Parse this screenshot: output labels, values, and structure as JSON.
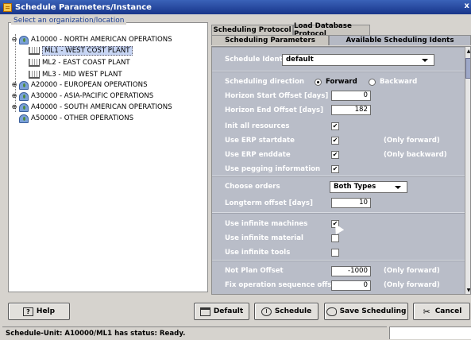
{
  "window": {
    "title": "Schedule Parameters/Instance",
    "close_glyph": "x"
  },
  "tree": {
    "legend": "Select an organization/location",
    "nodes": [
      {
        "label": "A10000 - NORTH AMERICAN OPERATIONS",
        "toggle": "⊖",
        "icon": "globe-icon"
      },
      {
        "label": "ML1 - WEST COST PLANT",
        "icon": "factory-icon",
        "selected": true
      },
      {
        "label": "ML2 - EAST COAST PLANT",
        "icon": "factory-icon"
      },
      {
        "label": "ML3 - MID WEST PLANT",
        "icon": "factory-icon"
      },
      {
        "label": "A20000 - EUROPEAN OPERATIONS",
        "toggle": "⊕",
        "icon": "globe-icon"
      },
      {
        "label": "A30000 - ASIA-PACIFIC OPERATIONS",
        "toggle": "⊕",
        "icon": "globe-icon"
      },
      {
        "label": "A40000 - SOUTH AMERICAN OPERATIONS",
        "toggle": "⊕",
        "icon": "globe-icon"
      },
      {
        "label": "A50000 - OTHER OPERATIONS",
        "icon": "globe-icon"
      }
    ]
  },
  "tabs": {
    "top": [
      "Scheduling Protocol",
      "Load Database Protocol"
    ],
    "second": [
      "Scheduling Parameters",
      "Available Scheduling Idents"
    ],
    "active": "Scheduling Parameters"
  },
  "form": {
    "schedule_ident": {
      "label": "Schedule Ident",
      "value": "default"
    },
    "direction": {
      "label": "Scheduling direction",
      "options": [
        "Forward",
        "Backward"
      ],
      "selected": "Forward"
    },
    "horizon_start": {
      "label": "Horizon Start Offset [days]",
      "value": "0"
    },
    "horizon_end": {
      "label": "Horizon End Offset [days]",
      "value": "182"
    },
    "init_all": {
      "label": "Init all resources",
      "checked": true
    },
    "erp_start": {
      "label": "Use ERP startdate",
      "checked": true,
      "note": "(Only forward)"
    },
    "erp_end": {
      "label": "Use ERP enddate",
      "checked": true,
      "note": "(Only backward)"
    },
    "pegging": {
      "label": "Use pegging information",
      "checked": true
    },
    "choose_orders": {
      "label": "Choose orders",
      "value": "Both Types"
    },
    "longterm": {
      "label": "Longterm offset [days]",
      "value": "10"
    },
    "inf_machines": {
      "label": "Use infinite machines",
      "checked": true
    },
    "inf_material": {
      "label": "Use infinite material",
      "checked": false
    },
    "inf_tools": {
      "label": "Use infinite tools",
      "checked": false
    },
    "not_plan": {
      "label": "Not Plan Offset",
      "value": "-1000",
      "note": "(Only forward)"
    },
    "fix_seq": {
      "label": "Fix operation sequence offset",
      "value": "0",
      "note": "(Only forward)"
    }
  },
  "buttons": {
    "help": "Help",
    "default": "Default",
    "schedule": "Schedule",
    "save": "Save Scheduling",
    "cancel": "Cancel"
  },
  "status": {
    "text": "Schedule-Unit: A10000/ML1  has status: Ready."
  },
  "colors": {
    "panel_bg": "#b9bdc8",
    "title_bar": "#18358a",
    "label_text": "#ffffff"
  }
}
